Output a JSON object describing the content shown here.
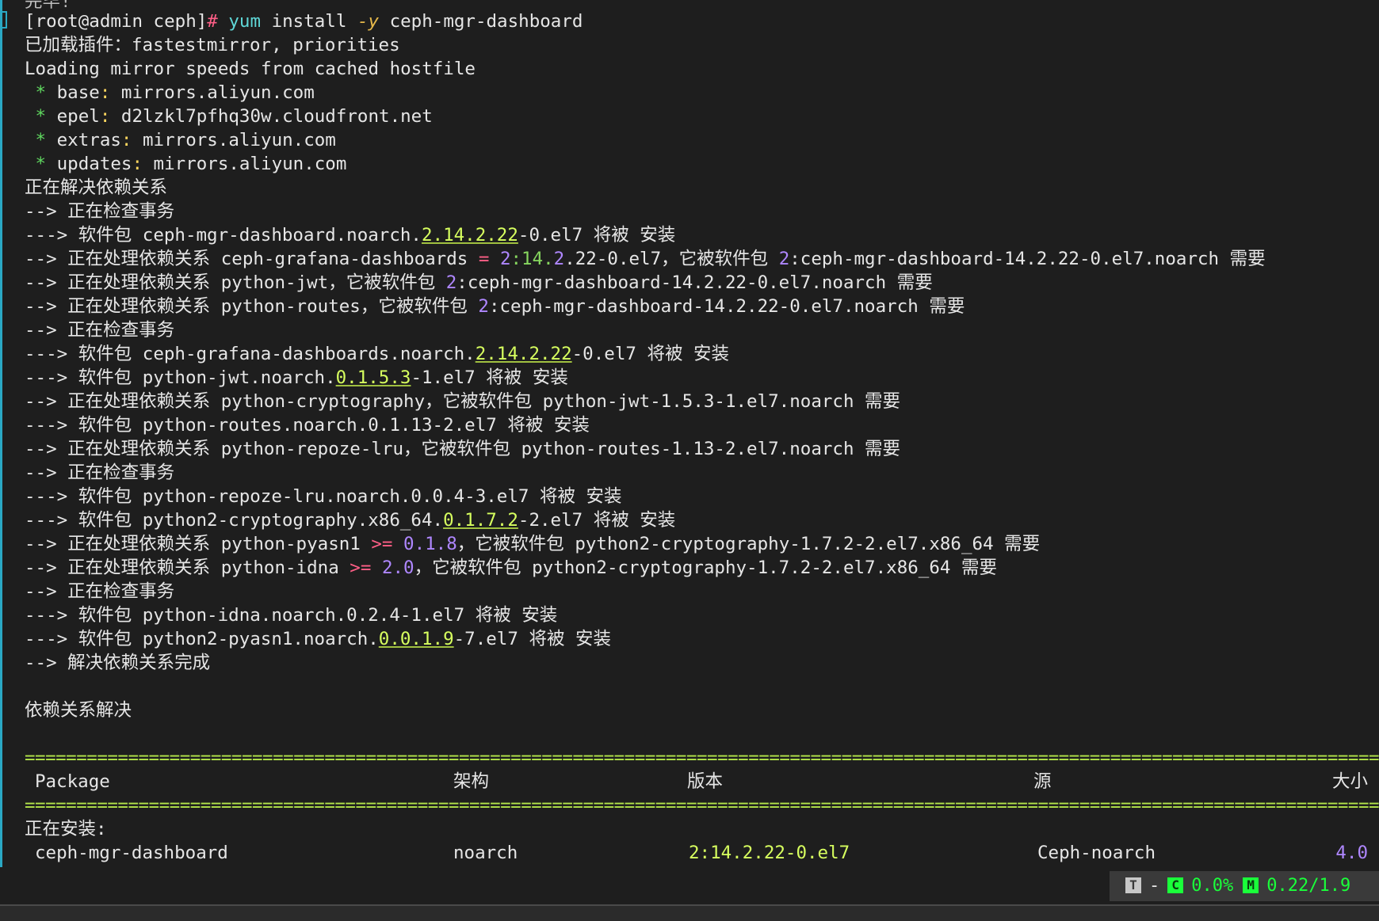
{
  "top_cutoff": "完毕!",
  "prompt": {
    "user_host": "[root@admin ceph]",
    "hash": "#",
    "cmd": "yum",
    "args1": " install ",
    "flag": "-y",
    "args2": " ceph-mgr-dashboard"
  },
  "lines": {
    "plugins": "已加载插件：fastestmirror, priorities",
    "loading": "Loading mirror speeds from cached hostfile",
    "base_key": "base",
    "base_val": " mirrors.aliyun.com",
    "epel_key": "epel",
    "epel_val": " d2lzkl7pfhq30w.cloudfront.net",
    "extras_key": "extras",
    "extras_val": " mirrors.aliyun.com",
    "updates_key": "updates",
    "updates_val": " mirrors.aliyun.com",
    "resolving": "正在解决依赖关系",
    "arrow2": "-->",
    "arrow3": "--->",
    "checking": " 正在检查事务",
    "pkg": " 软件包 ",
    "will_install": " 将被 安装",
    "processing": " 正在处理依赖关系 ",
    "required_by": "，它被软件包 ",
    "needed": " 需要",
    "l1_name": "ceph-mgr-dashboard.noarch.",
    "l1_ver": "2.14.2.22",
    "l1_rel": "-0.el7",
    "l2_dep": "ceph-grafana-dashboards",
    "l2_op": " = ",
    "l2_ver_a": "2",
    "l2_ver_b": ":14.",
    "l2_ver_c": "2",
    "l2_ver_d": ".22-0.el7",
    "l2_by_a": "2",
    "l2_by_b": ":ceph-mgr-dashboard-14.2.22-0.el7.noarch",
    "l3_dep": "python-jwt",
    "l4_dep": "python-routes",
    "l5_name": "ceph-grafana-dashboards.noarch.",
    "l5_ver": "2.14.2.22",
    "l5_rel": "-0.el7",
    "l6_name": "python-jwt.noarch.",
    "l6_ver": "0.1.5.3",
    "l6_rel": "-1.el7",
    "l7_dep": "python-cryptography",
    "l7_by": "python-jwt-1.5.3-1.el7.noarch",
    "l8_name": "python-routes.noarch.0.1.13-2.el7",
    "l9_dep": "python-repoze-lru",
    "l9_by": "python-routes-1.13-2.el7.noarch",
    "l10_name": "python-repoze-lru.noarch.0.0.4-3.el7",
    "l11_name": "python2-cryptography.x86_64.",
    "l11_ver": "0.1.7.2",
    "l11_rel": "-2.el7",
    "l12_dep": "python-pyasn1",
    "l12_op": " >= ",
    "l12_ver": "0.1.8",
    "l12_by": "python2-cryptography-1.7.2-2.el7.x86_64",
    "l13_dep": "python-idna",
    "l13_op": " >= ",
    "l13_ver": "2.0",
    "l13_by": "python2-cryptography-1.7.2-2.el7.x86_64",
    "l14_name": "python-idna.noarch.0.2.4-1.el7",
    "l15_name": "python2-pyasn1.noarch.",
    "l15_ver": "0.0.1.9",
    "l15_rel": "-7.el7",
    "resolved_done": " 解决依赖关系完成",
    "deps_resolved": "依赖关系解决",
    "installing": "正在安装:"
  },
  "table": {
    "headers": [
      "Package",
      "架构",
      "版本",
      "源",
      "大小"
    ],
    "row": {
      "package": "ceph-mgr-dashboard",
      "arch": "noarch",
      "version": "2:14.2.22-0.el7",
      "repo": "Ceph-noarch",
      "size": "4.0"
    }
  },
  "statusbar": {
    "t_label": "T",
    "dash": "-",
    "c_label": "C",
    "cpu": "0.0%",
    "m_label": "M",
    "mem": "0.22/1.9"
  },
  "colors": {
    "background": "#1e1e1e",
    "gutter": "#2aa8c4",
    "rule": "#b4e64a",
    "version_highlight": "#d7ff5f",
    "number": "#af87ff",
    "status_green": "#1aff3a"
  }
}
